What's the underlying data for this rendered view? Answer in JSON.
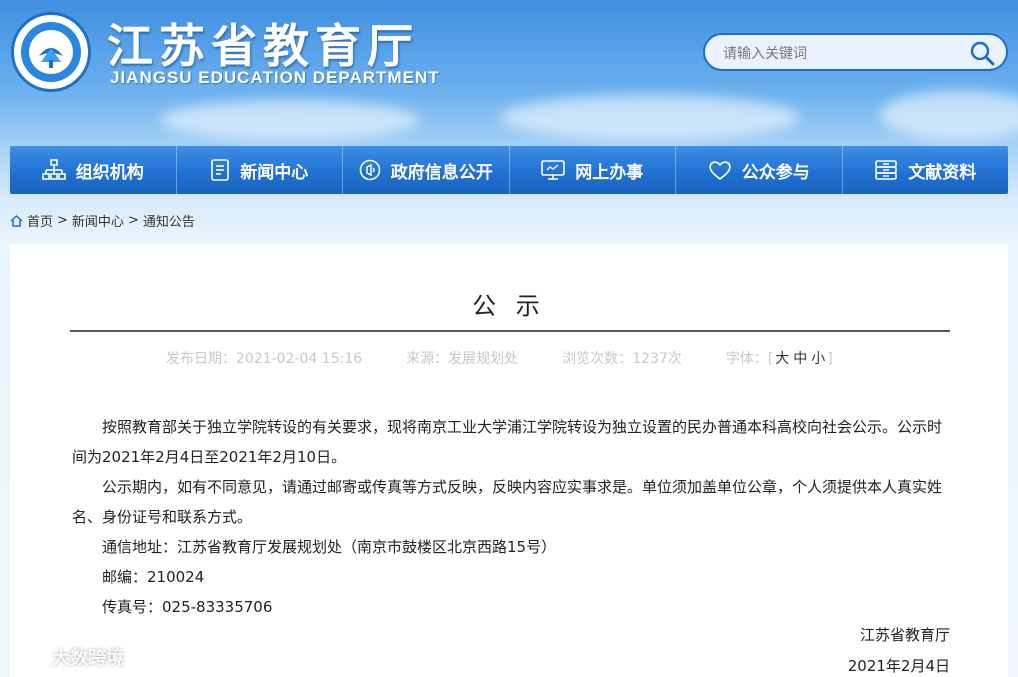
{
  "header": {
    "site_title": "江苏省教育厅",
    "site_subtitle": "JIANGSU EDUCATION DEPARTMENT",
    "search_placeholder": "请输入关键词",
    "brand_color": "#1f6fd0"
  },
  "nav": [
    {
      "label": "组织机构",
      "icon": "org-chart-icon"
    },
    {
      "label": "新闻中心",
      "icon": "document-icon"
    },
    {
      "label": "政府信息公开",
      "icon": "speaker-icon"
    },
    {
      "label": "网上办事",
      "icon": "monitor-icon"
    },
    {
      "label": "公众参与",
      "icon": "heart-icon"
    },
    {
      "label": "文献资料",
      "icon": "archive-icon"
    }
  ],
  "breadcrumb": {
    "home": "首页",
    "sep": ">",
    "level1": "新闻中心",
    "level2": "通知公告"
  },
  "article": {
    "title": "公 示",
    "meta": {
      "date": "发布日期：2021-02-04 15:16",
      "source": "来源：发展规划处",
      "views": "浏览次数：1237次",
      "font_label": "字体：[",
      "font_large": "大",
      "font_medium": "中",
      "font_small": "小",
      "font_close": "]"
    },
    "paragraphs": [
      "按照教育部关于独立学院转设的有关要求，现将南京工业大学浦江学院转设为独立设置的民办普通本科高校向社会公示。公示时间为2021年2月4日至2021年2月10日。",
      "公示期内，如有不同意见，请通过邮寄或传真等方式反映，反映内容应实事求是。单位须加盖单位公章，个人须提供本人真实姓名、身份证号和联系方式。",
      "通信地址：江苏省教育厅发展规划处（南京市鼓楼区北京西路15号）",
      "邮编：210024",
      "传真号：025-83335706"
    ],
    "signature": "江苏省教育厅",
    "sign_date": "2021年2月4日"
  },
  "watermark": "大数跨境"
}
